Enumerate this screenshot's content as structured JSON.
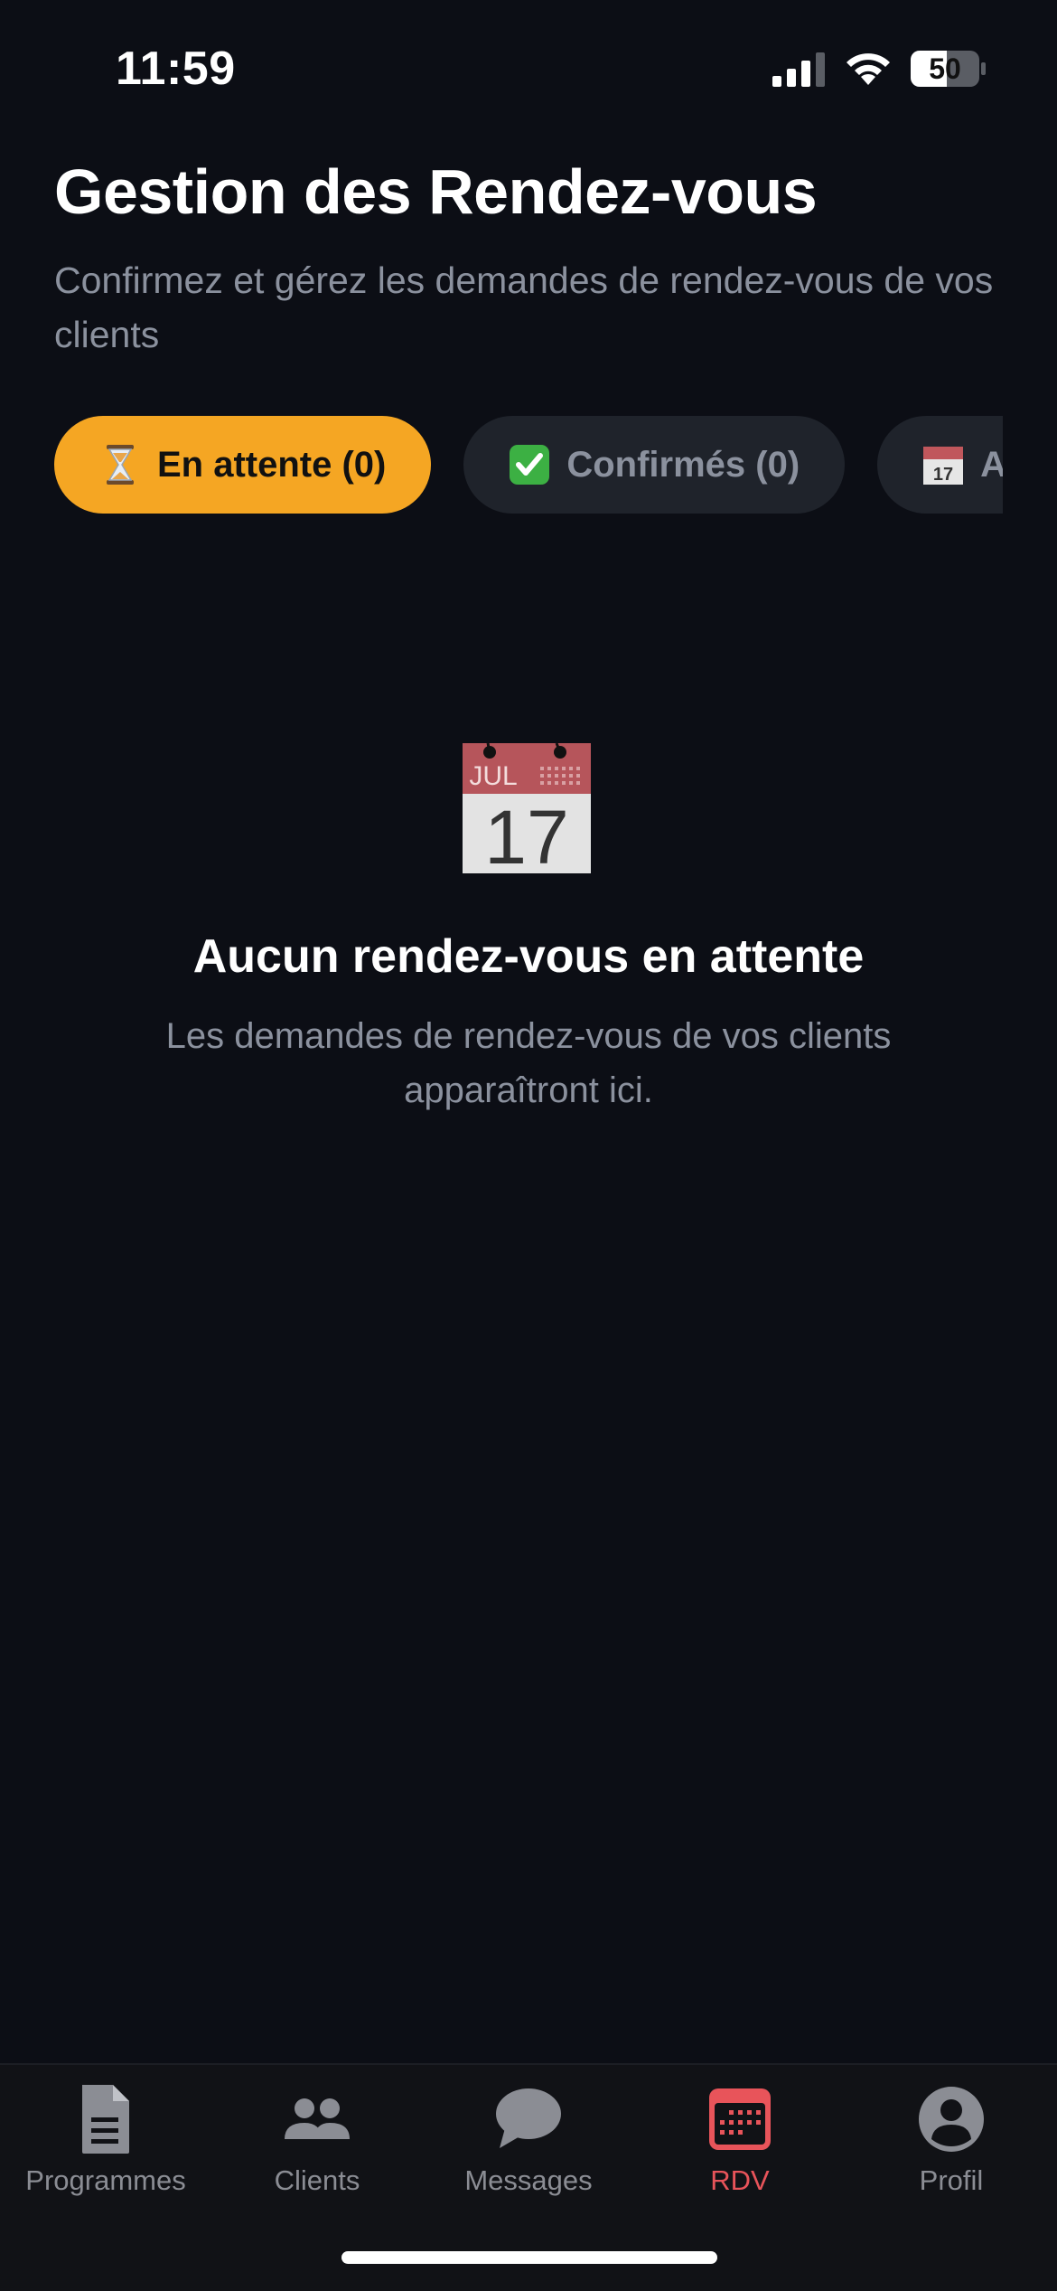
{
  "status_bar": {
    "time": "11:59",
    "battery": "50",
    "icons": [
      "signal-icon",
      "wifi-icon",
      "battery-icon"
    ]
  },
  "header": {
    "title": "Gestion des Rendez-vous",
    "subtitle": "Confirmez et gérez les demandes de rendez-vous de vos clients"
  },
  "tabs": [
    {
      "label": "En attente (0)",
      "icon": "hourglass-icon",
      "active": true
    },
    {
      "label": "Confirmés (0)",
      "icon": "check-mark-icon",
      "active": false
    },
    {
      "label": "A",
      "icon": "calendar-icon",
      "active": false
    }
  ],
  "empty_state": {
    "icon": "calendar-icon",
    "icon_month": "JUL",
    "icon_day": "17",
    "title": "Aucun rendez-vous en attente",
    "description": "Les demandes de rendez-vous de vos clients apparaîtront ici."
  },
  "bottom_nav": {
    "items": [
      {
        "label": "Programmes",
        "icon": "document-icon",
        "active": false
      },
      {
        "label": "Clients",
        "icon": "people-icon",
        "active": false
      },
      {
        "label": "Messages",
        "icon": "chat-bubble-icon",
        "active": false
      },
      {
        "label": "RDV",
        "icon": "calendar-grid-icon",
        "active": true
      },
      {
        "label": "Profil",
        "icon": "profile-icon",
        "active": false
      }
    ]
  },
  "colors": {
    "background": "#0c0e15",
    "accent": "#f5a623",
    "active_nav": "#e8545a",
    "muted_text": "#8b919e"
  }
}
